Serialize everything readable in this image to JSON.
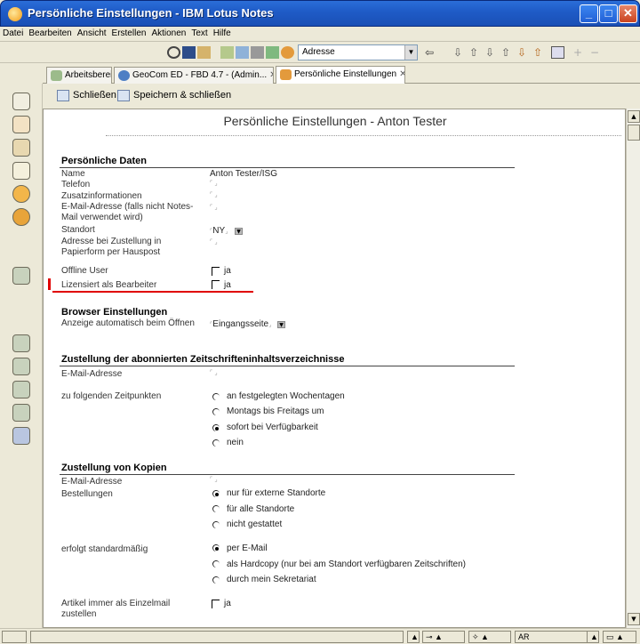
{
  "window": {
    "title": "Persönliche Einstellungen - IBM Lotus Notes",
    "min_icon": "minimize-icon",
    "max_icon": "maximize-icon",
    "close_icon": "close-icon"
  },
  "menu": [
    "Datei",
    "Bearbeiten",
    "Ansicht",
    "Erstellen",
    "Aktionen",
    "Text",
    "Hilfe"
  ],
  "toolbar": {
    "address_label": "Adresse"
  },
  "tabs": [
    {
      "label": "Arbeitsbereich",
      "icon": "workspace-icon",
      "active": false
    },
    {
      "label": "GeoCom ED - FBD 4.7 - (Admin...",
      "icon": "database-icon",
      "active": false
    },
    {
      "label": "Persönliche Einstellungen",
      "icon": "settings-icon",
      "active": true
    }
  ],
  "actions": {
    "close": "Schließen",
    "save_close": "Speichern & schließen"
  },
  "doc": {
    "title": "Persönliche Einstellungen - Anton Tester",
    "sections": {
      "personal": {
        "heading": "Persönliche Daten",
        "name_label": "Name",
        "name_value": "Anton Tester/ISG",
        "phone_label": "Telefon",
        "info_label": "Zusatzinformationen",
        "email_label": "E-Mail-Adresse (falls nicht Notes-Mail verwendet wird)",
        "location_label": "Standort",
        "location_value": "NY",
        "postal_label": "Adresse bei Zustellung in Papierform per Hauspost",
        "offline_label": "Offline User",
        "offline_value": "ja",
        "licensed_label": "Lizensiert als Bearbeiter",
        "licensed_value": "ja"
      },
      "browser": {
        "heading": "Browser Einstellungen",
        "display_label": "Anzeige automatisch beim Öffnen",
        "display_value": "Eingangsseite"
      },
      "toc": {
        "heading": "Zustellung der abonnierten Zeitschrifteninhaltsverzeichnisse",
        "email_label": "E-Mail-Adresse",
        "times_label": "zu folgenden Zeitpunkten",
        "options": [
          "an festgelegten Wochentagen",
          "Montags bis Freitags um",
          "sofort bei Verfügbarkeit",
          "nein"
        ],
        "selected": 2
      },
      "copies": {
        "heading": "Zustellung von Kopien",
        "email_label": "E-Mail-Adresse",
        "orders_label": "Bestellungen",
        "order_options": [
          "nur für externe Standorte",
          "für alle Standorte",
          "nicht gestattet"
        ],
        "order_selected": 0,
        "default_label": "erfolgt standardmäßig",
        "default_options": [
          "per E-Mail",
          "als Hardcopy (nur bei am Standort verfügbaren Zeitschriften)",
          "durch mein Sekretariat"
        ],
        "default_selected": 0,
        "single_label": "Artikel immer als Einzelmail zustellen",
        "single_value": "ja"
      }
    }
  },
  "status": {
    "lang": "AR"
  },
  "accent_color": "#e00000"
}
